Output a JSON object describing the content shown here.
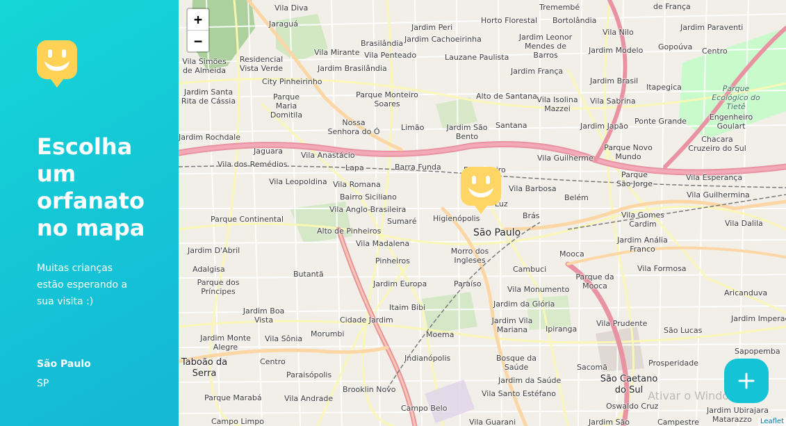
{
  "sidebar": {
    "title": "Escolha um orfanato no mapa",
    "subtitle": "Muitas crianças estão esperando a sua visita :)",
    "city": "São Paulo",
    "state": "SP"
  },
  "map": {
    "zoom_in": "+",
    "zoom_out": "−",
    "attribution": "Leaflet",
    "watermark": "Ativar o Windows",
    "labels": [
      "Vila Diva",
      "Jardim Peri",
      "Horto Florestal",
      "Tremembé",
      "de França",
      "Jaraguá",
      "Jardim Cachoeirinha",
      "Bortolândia",
      "Jardim Paraventi",
      "Brasilândia",
      "Jardim Leonor Mendes de Barros",
      "Vila Nilo",
      "Vila Mirante",
      "Vila Penteado",
      "Lauzane Paulista",
      "Jardim Modelo",
      "Gopoúva",
      "Centro",
      "Residencial Vista Verde",
      "Vila Simões de Almeida",
      "Jardim Brasilândia",
      "Jardim França",
      "Jardim Brasil",
      "City Pinheirinho",
      "Itapegica",
      "Jardim Santa Rita de Cássia",
      "Parque Maria Domitila",
      "Parque Monteiro Soares",
      "Alto de Santana",
      "Vila Isolina Mazzei",
      "Vila Sabrina",
      "Parque Ecológico do Tietê",
      "Nossa Senhora do Ó",
      "Limão",
      "Jardim São Bento",
      "Santana",
      "Jardim Japão",
      "Ponte Grande",
      "Engenheiro Goulart",
      "Jardim Rochdale",
      "Jaguara",
      "Vila Anastácio",
      "Parque Novo Mundo",
      "Chacara Cruzeiro do Sul",
      "Vila Guilherme",
      "Vila dos Remédios",
      "Lapa",
      "Barra Funda",
      "Parque São Jorge",
      "Vila Esperança",
      "Vila Leopoldina",
      "Vila Romana",
      "Bom Retiro",
      "Vila Barbosa",
      "Bairro Siciliano",
      "Luz",
      "Belém",
      "Vila Guilhermina",
      "Vila Anglo-Brasileira",
      "Parque Continental",
      "Sumaré",
      "Higienópolis",
      "Brás",
      "Vila Gomes Cardim",
      "Vila Dalila",
      "Alto de Pinheiros",
      "São Paulo",
      "Jardim Anália Franco",
      "Jardim D'Abril",
      "Vila Madalena",
      "Morro dos Ingleses",
      "Mooca",
      "Adalgisa",
      "Butantã",
      "Pinheiros",
      "Cambuci",
      "Vila Formosa",
      "Parque dos Príncipes",
      "Jardim Europa",
      "Paraíso",
      "Parque da Mooca",
      "Vila Monumento",
      "Aricanduva",
      "Itaim Bibi",
      "Jardim da Glória",
      "Jardim Boa Vista",
      "Cidade Jardim",
      "Jardim Vila Mariana",
      "Vila Prudente",
      "Jardim Imperador",
      "Jardim Monte Alegre",
      "Vila Sônia",
      "Morumbi",
      "Ipiranga",
      "São Lucas",
      "Moema",
      "Sapopemba",
      "Taboão da Serra",
      "Indianópolis",
      "Bosque da Saúde",
      "Sacomã",
      "Prosperidade",
      "Centro",
      "Paraisópolis",
      "Jardim da Saúde",
      "São Caetano do Sul",
      "Parque Marabá",
      "Vila Andrade",
      "Brooklin Novo",
      "Vila Santo Estéfano",
      "Oswaldo Cruz",
      "Campo Belo",
      "Jardim Ubirajara",
      "Matarazzo",
      "Campo Limpo",
      "Vila Guarani",
      "Jardim São",
      "Campestre"
    ]
  },
  "colors": {
    "sidebar_gradient_start": "#15b6d6",
    "sidebar_gradient_end": "#15d6d6",
    "marker_yellow": "#ffd666",
    "add_button": "#15c3d6"
  },
  "icons": {
    "logo": "smiley-pin-icon",
    "marker": "smiley-pin-icon",
    "add": "plus-icon"
  }
}
